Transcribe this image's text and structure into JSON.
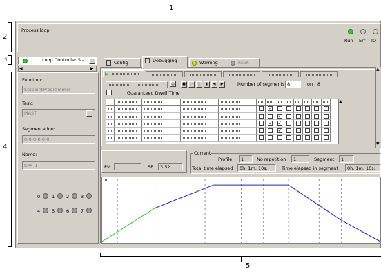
{
  "callouts": {
    "n1": "1",
    "n2": "2",
    "n3": "3",
    "n4": "4",
    "n5": "5"
  },
  "header": {
    "title": "Process loop",
    "status": [
      {
        "label": "Run",
        "color": "#2ec82e"
      },
      {
        "label": "Err",
        "color": "#d4d0c8"
      },
      {
        "label": "IO",
        "color": "#d4d0c8"
      }
    ]
  },
  "selector": {
    "value": "Loop Controller S - L"
  },
  "tabs": [
    {
      "label": "Config",
      "icon": "config-icon"
    },
    {
      "label": "Debugging",
      "icon": "debug-icon"
    },
    {
      "label": "Warning",
      "icon": "warning-icon"
    },
    {
      "label": "Fault",
      "icon": "fault-icon"
    }
  ],
  "left": {
    "function_label": "Function:",
    "function_value": "SetpointProgrammer",
    "task_label": "Task:",
    "task_value": "MAST",
    "segmentation_label": "Segmentation:",
    "segmentation_value": "0-0-0-0-0-0",
    "name_label": "Name:",
    "name_value": "SPP_1",
    "indicators": [
      "0",
      "1",
      "2",
      "3",
      "4",
      "5",
      "6",
      "7"
    ]
  },
  "program": {
    "guaranteed_label": "Guaranteed Dwell Time",
    "segments_label": "Number of segments",
    "segments_value": "8",
    "on_label": "on",
    "on_value": "8",
    "checks": [
      [
        false,
        true,
        false,
        false,
        false,
        false,
        false,
        false
      ],
      [
        false,
        false,
        true,
        false,
        false,
        false,
        false,
        false
      ],
      [
        false,
        true,
        true,
        false,
        false,
        false,
        false,
        false
      ],
      [
        false,
        false,
        true,
        false,
        false,
        false,
        false,
        false
      ],
      [
        false,
        false,
        false,
        false,
        false,
        false,
        false,
        false
      ]
    ]
  },
  "values": {
    "pv_label": "PV",
    "pv_value": "",
    "sp_label": "SP",
    "sp_value": "3.52"
  },
  "current": {
    "title": "Current",
    "profile_label": "Profile",
    "profile_value": "1",
    "norep_label": "No repetition",
    "norep_value": "1",
    "segment_label": "Segment",
    "segment_value": "1",
    "total_label": "Total time elapsed",
    "total_value": "0h. 1m. 10s.",
    "seg_time_label": "Time elapsed in segment",
    "seg_time_value": "0h. 1m. 10s."
  },
  "profile_chart": {
    "elapsed_fraction": 0.19,
    "profile_points": [
      [
        0,
        0.0
      ],
      [
        0.19,
        0.55
      ],
      [
        0.4,
        0.93
      ],
      [
        0.67,
        0.93
      ],
      [
        0.86,
        0.35
      ],
      [
        1.0,
        0.0
      ]
    ],
    "colors": {
      "elapsed": "#2ec82e",
      "remaining": "#2020d8"
    }
  }
}
